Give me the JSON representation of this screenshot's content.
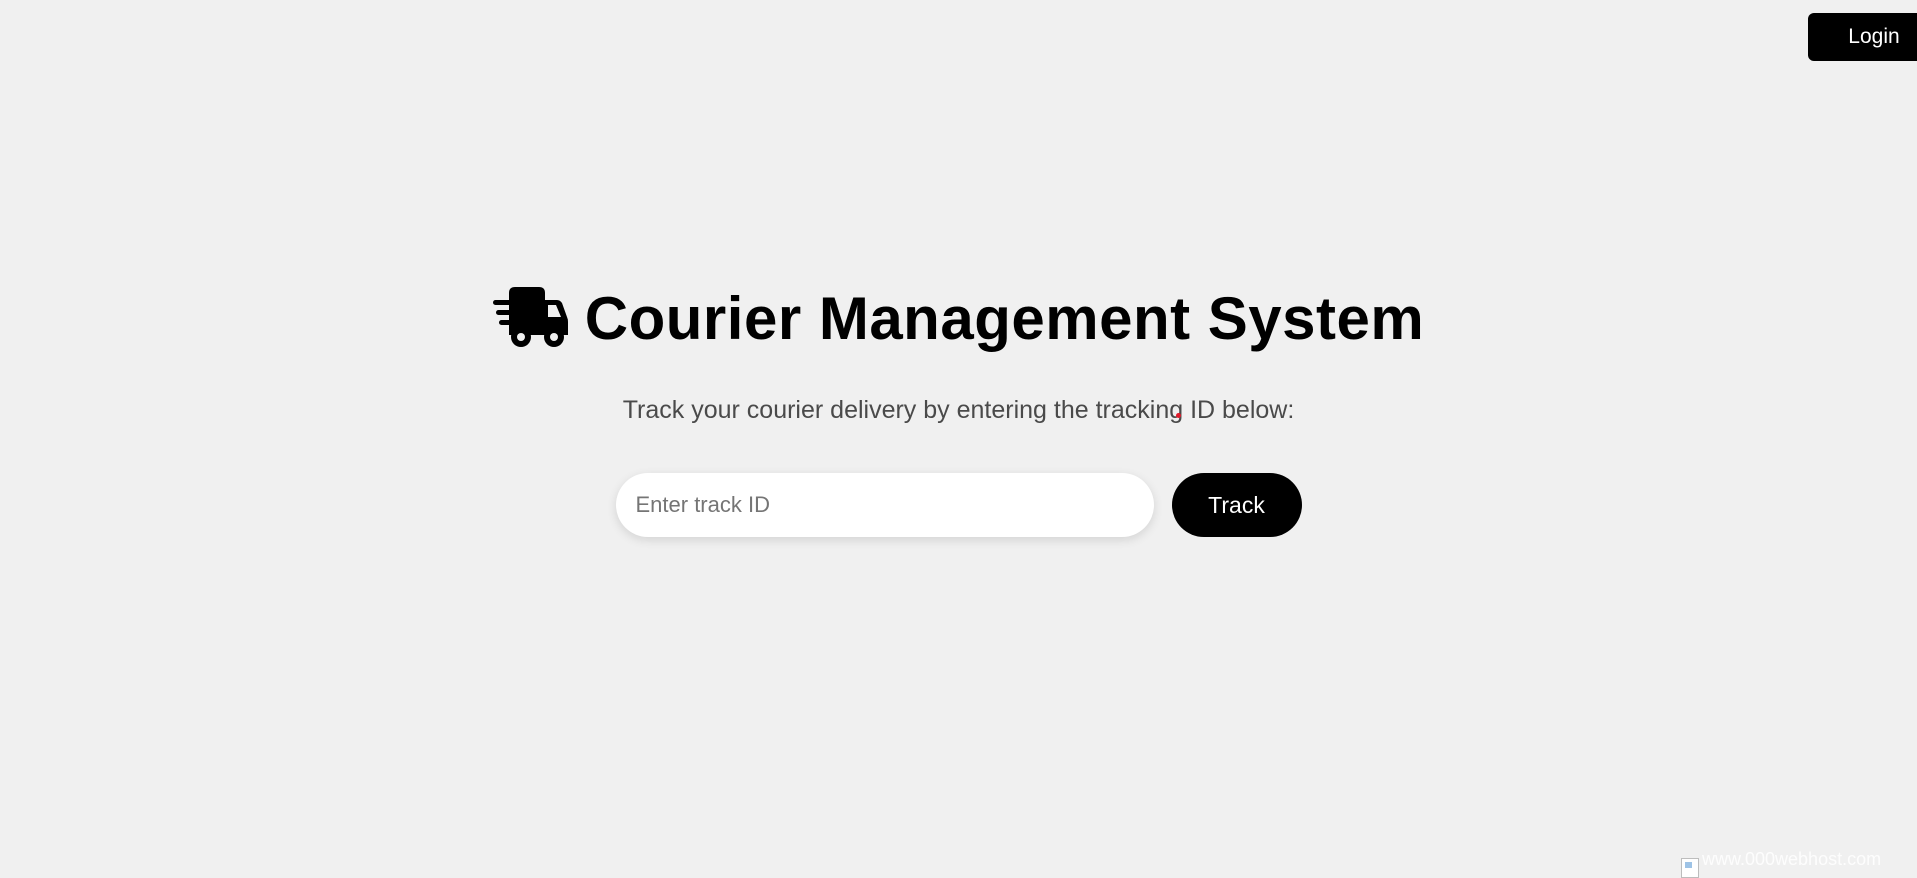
{
  "header": {
    "login_label": "Login"
  },
  "hero": {
    "icon": "truck-fast-icon",
    "title": "Courier Management System",
    "subtitle": "Track your courier delivery by entering the tracking ID below:"
  },
  "track_form": {
    "input_placeholder": "Enter track ID",
    "input_value": "",
    "button_label": "Track"
  },
  "footer": {
    "watermark_text": "www.000webhost.com"
  },
  "colors": {
    "background": "#f0f0f0",
    "button": "#000000",
    "button_text": "#ffffff",
    "subtitle_text": "#4a4a4a",
    "marker": "#e21b2c"
  }
}
